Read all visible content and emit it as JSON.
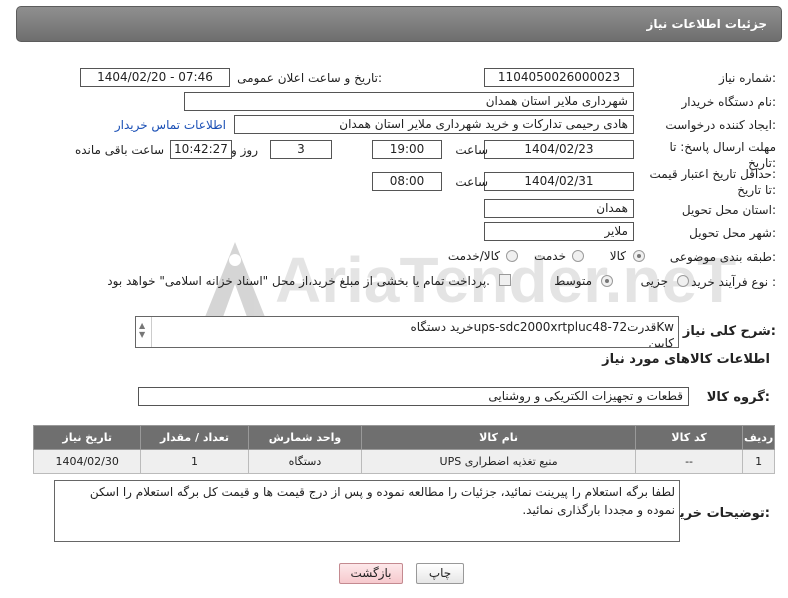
{
  "header": {
    "title": "جزئیات اطلاعات نیاز"
  },
  "need_number": {
    "label": "شماره نیاز:",
    "value": "1104050026000023"
  },
  "announce": {
    "label": "تاریخ و ساعت اعلان عمومی:",
    "value": "1404/02/20 - 07:46"
  },
  "buyer_org": {
    "label": "نام دستگاه خریدار:",
    "value": "شهرداری ملایر استان همدان"
  },
  "creator": {
    "label": "ایجاد کننده درخواست:",
    "value": "هادی رحیمی تدارکات و خرید شهرداری ملایر استان همدان",
    "contact_link": "اطلاعات تماس خریدار"
  },
  "deadline": {
    "label_line1": "مهلت ارسال پاسخ: تا",
    "label_line2": "تاریخ:",
    "date": "1404/02/23",
    "time_label": "ساعت",
    "time": "19:00",
    "days": "3",
    "days_label": "روز و",
    "remaining": "10:42:27",
    "remaining_label": "ساعت باقی مانده"
  },
  "price_validity": {
    "label_line1": "حداقل تاریخ اعتبار قیمت:",
    "label_line2": "تا تاریخ:",
    "date": "1404/02/31",
    "time_label": "ساعت",
    "time": "08:00"
  },
  "province": {
    "label": "استان محل تحویل:",
    "value": "همدان"
  },
  "city": {
    "label": "شهر محل تحویل:",
    "value": "ملایر"
  },
  "category": {
    "label": "طبقه بندی موضوعی:",
    "options": [
      "کالا",
      "خدمت",
      "کالا/خدمت"
    ],
    "selected": "کالا"
  },
  "process": {
    "label": "نوع فرآیند خرید :",
    "options": [
      "جزیی",
      "متوسط"
    ],
    "selected": "متوسط",
    "payment_note": "پرداخت تمام یا بخشی از مبلغ خرید،از محل \"اسناد خزانه اسلامی\" خواهد بود."
  },
  "description": {
    "label": "شرح کلی نیاز:",
    "line1": "خرید دستگاهups-sdc2000xrtpluc48-7قدرت2Kw",
    "line2": "کابین"
  },
  "goods_info": {
    "title": "اطلاعات کالاهای مورد نیاز"
  },
  "goods_group": {
    "label": "گروه کالا:",
    "value": "قطعات و تجهیزات الکتریکی و روشنایی"
  },
  "table": {
    "headers": [
      "ردیف",
      "کد کالا",
      "نام کالا",
      "واحد شمارش",
      "تعداد / مقدار",
      "تاریخ نیاز"
    ],
    "rows": [
      [
        "1",
        "--",
        "منبع تغذیه اضطراری UPS",
        "دستگاه",
        "1",
        "1404/02/30"
      ]
    ]
  },
  "buyer_notes": {
    "label": "توضیحات خریدار:",
    "text": "لطفا برگه استعلام را پیرینت نمائید، جزئیات را مطالعه نموده و پس از درج قیمت ها و قیمت کل برگه استعلام را اسکن نموده و مجددا بارگذاری نمائید."
  },
  "buttons": {
    "print": "چاپ",
    "back": "بازگشت"
  },
  "watermark_text": "AriaTender.neT"
}
